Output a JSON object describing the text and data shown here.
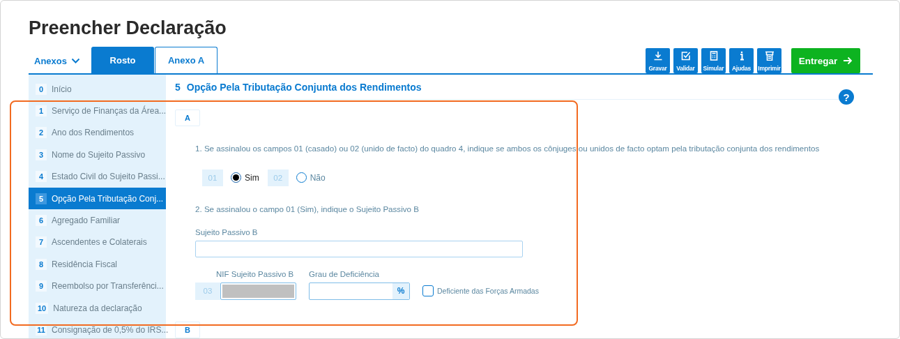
{
  "page": {
    "title": "Preencher Declaração"
  },
  "annexes_menu": {
    "label": "Anexos"
  },
  "tabs": [
    {
      "label": "Rosto",
      "selected": true
    },
    {
      "label": "Anexo A",
      "selected": false
    }
  ],
  "toolbar": [
    {
      "kind": "download",
      "label": "Gravar"
    },
    {
      "kind": "validate",
      "label": "Validar"
    },
    {
      "kind": "calculator",
      "label": "Simular"
    },
    {
      "kind": "info",
      "label": "Ajudas"
    },
    {
      "kind": "printer",
      "label": "Imprimir"
    }
  ],
  "submit_button": {
    "label": "Entregar"
  },
  "sidebar": {
    "items": [
      {
        "number": "0",
        "label": "Início",
        "selected": false
      },
      {
        "number": "1",
        "label": "Serviço de Finanças da Área...",
        "selected": false
      },
      {
        "number": "2",
        "label": "Ano dos Rendimentos",
        "selected": false
      },
      {
        "number": "3",
        "label": "Nome do Sujeito Passivo",
        "selected": false
      },
      {
        "number": "4",
        "label": "Estado Civil do Sujeito Passi...",
        "selected": false
      },
      {
        "number": "5",
        "label": "Opção Pela Tributação Conj...",
        "selected": true
      },
      {
        "number": "6",
        "label": "Agregado Familiar",
        "selected": false
      },
      {
        "number": "7",
        "label": "Ascendentes e Colaterais",
        "selected": false
      },
      {
        "number": "8",
        "label": "Residência Fiscal",
        "selected": false
      },
      {
        "number": "9",
        "label": "Reembolso por Transferênci...",
        "selected": false
      },
      {
        "number": "10",
        "label": "Natureza da declaração",
        "selected": false
      },
      {
        "number": "11",
        "label": "Consignação de 0,5% do IRS...",
        "selected": false
      }
    ]
  },
  "section": {
    "number": "5",
    "title": "Opção Pela Tributação Conjunta dos Rendimentos",
    "help": "?"
  },
  "quadro_a": {
    "label": "A",
    "question_1": "1. Se assinalou os campos 01 (casado) ou 02 (unido de facto) do quadro 4, indique se ambos os cônjuges ou unidos de facto optam pela tributação conjunta dos rendimentos",
    "options": [
      {
        "code": "01",
        "label": "Sim",
        "selected": true
      },
      {
        "code": "02",
        "label": "Não",
        "selected": false
      }
    ],
    "question_2": "2. Se assinalou o campo 01 (Sim), indique o Sujeito Passivo B",
    "name_field": {
      "label": "Sujeito Passivo B"
    },
    "nif_field": {
      "code": "03",
      "label": "NIF Sujeito Passivo B",
      "redacted": true
    },
    "disability_field": {
      "label": "Grau de Deficiência",
      "unit": "%"
    },
    "armed_forces": {
      "label": "Deficiente das Forças Armadas",
      "checked": false
    }
  },
  "quadro_b": {
    "label": "B"
  },
  "annotation_frame": true
}
